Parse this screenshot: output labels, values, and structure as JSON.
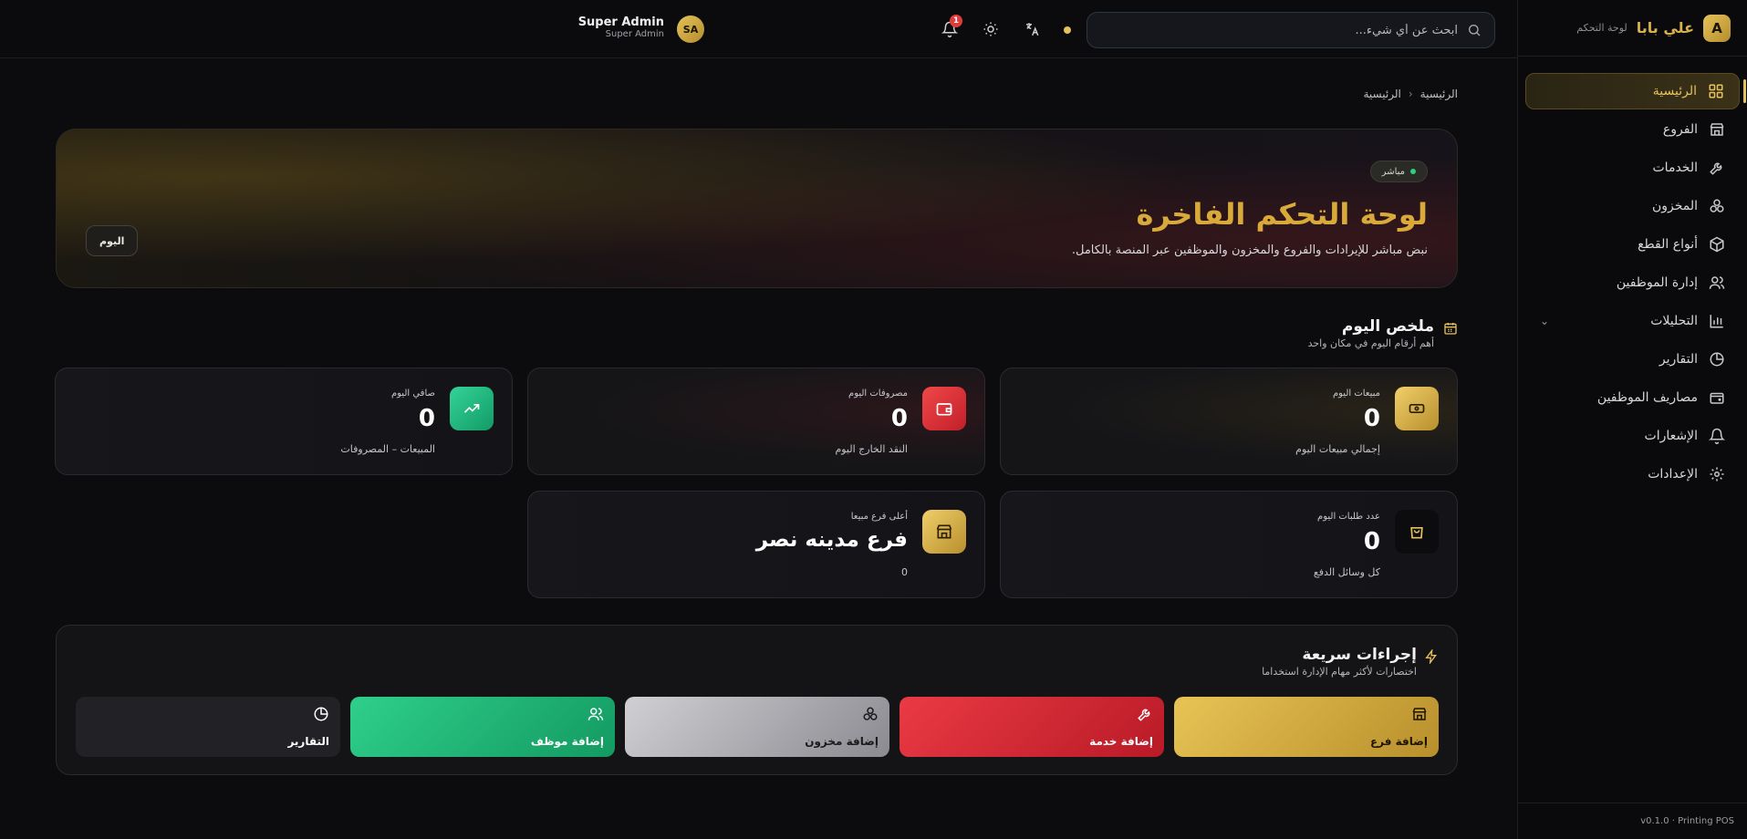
{
  "sidebar": {
    "brand_letter": "A",
    "brand_name": "علي بابا",
    "brand_sub": "لوحة التحكم",
    "items": [
      {
        "label": "الرئيسية",
        "icon": "grid-icon"
      },
      {
        "label": "الفروع",
        "icon": "store-icon"
      },
      {
        "label": "الخدمات",
        "icon": "wrench-icon"
      },
      {
        "label": "المخزون",
        "icon": "boxes-icon"
      },
      {
        "label": "أنواع القطع",
        "icon": "package-icon"
      },
      {
        "label": "إدارة الموظفين",
        "icon": "users-icon"
      },
      {
        "label": "التحليلات",
        "icon": "bar-chart-icon"
      },
      {
        "label": "التقارير",
        "icon": "pie-chart-icon"
      },
      {
        "label": "مصاريف الموظفين",
        "icon": "wallet-icon"
      },
      {
        "label": "الإشعارات",
        "icon": "bell-icon"
      },
      {
        "label": "الإعدادات",
        "icon": "gear-icon"
      }
    ],
    "footer": "v0.1.0 · Printing POS"
  },
  "topbar": {
    "search_placeholder": "ابحث عن أي شيء...",
    "notification_count": "1",
    "avatar_initials": "SA",
    "user_name": "Super Admin",
    "user_role": "Super Admin"
  },
  "breadcrumb": {
    "root": "الرئيسية",
    "current": "الرئيسية"
  },
  "hero": {
    "badge": "مباشر",
    "title": "لوحة التحكم الفاخرة",
    "subtitle": "نبض مباشر للإيرادات والفروع والمخزون والموظفين عبر المنصة بالكامل.",
    "today_button": "اليوم"
  },
  "summary": {
    "title": "ملخص اليوم",
    "subtitle": "أهم أرقام اليوم في مكان واحد",
    "cards": {
      "sales": {
        "label": "مبيعات اليوم",
        "value": "0",
        "foot": "إجمالي مبيعات اليوم"
      },
      "expenses": {
        "label": "مصروفات اليوم",
        "value": "0",
        "foot": "النقد الخارج اليوم"
      },
      "net": {
        "label": "صافي اليوم",
        "value": "0",
        "foot": "المبيعات – المصروفات"
      },
      "orders": {
        "label": "عدد طلبات اليوم",
        "value": "0",
        "foot": "كل وسائل الدفع"
      },
      "top_branch": {
        "label": "أعلى فرع مبيعا",
        "value": "فرع مدينه نصر",
        "foot": "0"
      }
    }
  },
  "quick_actions": {
    "title": "إجراءات سريعة",
    "subtitle": "اختصارات لأكثر مهام الإدارة استخداما",
    "buttons": [
      {
        "label": "إضافة فرع",
        "icon": "store-icon"
      },
      {
        "label": "إضافة خدمة",
        "icon": "wrench-icon"
      },
      {
        "label": "إضافة مخزون",
        "icon": "boxes-icon"
      },
      {
        "label": "إضافة موظف",
        "icon": "users-icon"
      },
      {
        "label": "التقارير",
        "icon": "pie-chart-icon"
      }
    ]
  },
  "colors": {
    "accent_gold": "#e6c25a",
    "danger_red": "#e23b3b",
    "success_green": "#2fcf7c",
    "background": "#0c0c0f"
  }
}
